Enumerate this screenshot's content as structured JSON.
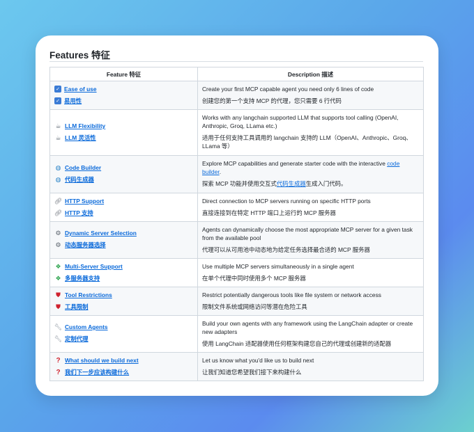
{
  "heading": "Features 特征",
  "table": {
    "col_feature": "Feature 特征",
    "col_description": "Description 描述",
    "rows": [
      {
        "icon": "checkbox-icon",
        "feature_en": "Ease of use",
        "feature_zh": "易用性",
        "desc_en": "Create your first MCP capable agent you need only 6 lines of code",
        "desc_zh": "创建您的第一个支持 MCP 的代理，您只需要 6 行代码"
      },
      {
        "icon": "teapot-icon",
        "feature_en": "LLM Flexibility",
        "feature_zh": "LLM 灵活性",
        "desc_en": "Works with any langchain supported LLM that supports tool calling (OpenAI, Anthropic, Groq, LLama etc.)",
        "desc_zh": "适用于任何支持工具调用的 langchain 支持的 LLM（OpenAI、Anthropic、Groq、LLama 等）"
      },
      {
        "icon": "globe-icon",
        "feature_en": "Code Builder",
        "feature_zh": "代码生成器",
        "desc_en_pre": "Explore MCP capabilities and generate starter code with the interactive ",
        "desc_en_link": "code builder",
        "desc_en_post": ".",
        "desc_zh_pre": "探索 MCP 功能并使用交互式",
        "desc_zh_link": "代码生成器",
        "desc_zh_post": "生成入门代码。"
      },
      {
        "icon": "link-icon",
        "feature_en": "HTTP Support",
        "feature_zh": "HTTP 支持",
        "desc_en": "Direct connection to MCP servers running on specific HTTP ports",
        "desc_zh": "直接连接到在特定 HTTP 端口上运行的 MCP 服务器"
      },
      {
        "icon": "gear-icon",
        "feature_en": "Dynamic Server Selection",
        "feature_zh": "动态服务器选择",
        "desc_en": "Agents can dynamically choose the most appropriate MCP server for a given task from the available pool",
        "desc_zh": "代理可以从可用池中动态地为给定任务选择最合适的 MCP 服务器"
      },
      {
        "icon": "puzzle-icon",
        "feature_en": "Multi-Server Support",
        "feature_zh": "多服务器支持",
        "desc_en": "Use multiple MCP servers simultaneously in a single agent",
        "desc_zh": "在单个代理中同时使用多个 MCP 服务器"
      },
      {
        "icon": "shield-icon",
        "feature_en": "Tool Restrictions",
        "feature_zh": "工具限制",
        "desc_en": "Restrict potentially dangerous tools like file system or network access",
        "desc_zh": "限制文件系统或网络访问等潜在危险工具"
      },
      {
        "icon": "wrench-icon",
        "feature_en": "Custom Agents",
        "feature_zh": "定制代理",
        "desc_en": "Build your own agents with any framework using the LangChain adapter or create new adapters",
        "desc_zh": "使用 LangChain 适配器使用任何框架构建您自己的代理或创建新的适配器"
      },
      {
        "icon": "question-icon",
        "feature_en": "What should we build next",
        "feature_zh": "我们下一步应该构建什么",
        "desc_en": "Let us know what you'd like us to build next",
        "desc_zh": "让我们知道您希望我们接下来构建什么"
      }
    ]
  },
  "colors": {
    "link": "#0969da",
    "border": "#d0d7de",
    "stripe": "#f6f8fa"
  }
}
